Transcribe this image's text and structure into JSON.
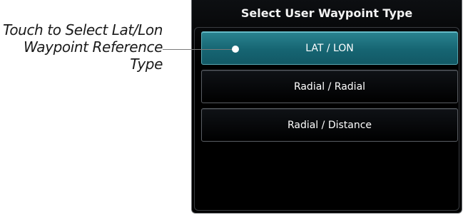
{
  "callout": {
    "lines": [
      "Touch to Select Lat/Lon",
      "Waypoint Reference",
      "Type"
    ]
  },
  "dialog": {
    "title": "Select User Waypoint Type",
    "options": [
      {
        "label": "LAT / LON",
        "selected": true
      },
      {
        "label": "Radial / Radial",
        "selected": false
      },
      {
        "label": "Radial / Distance",
        "selected": false
      }
    ]
  },
  "colors": {
    "selected_fill": "#166572",
    "panel_bg": "#000000"
  }
}
